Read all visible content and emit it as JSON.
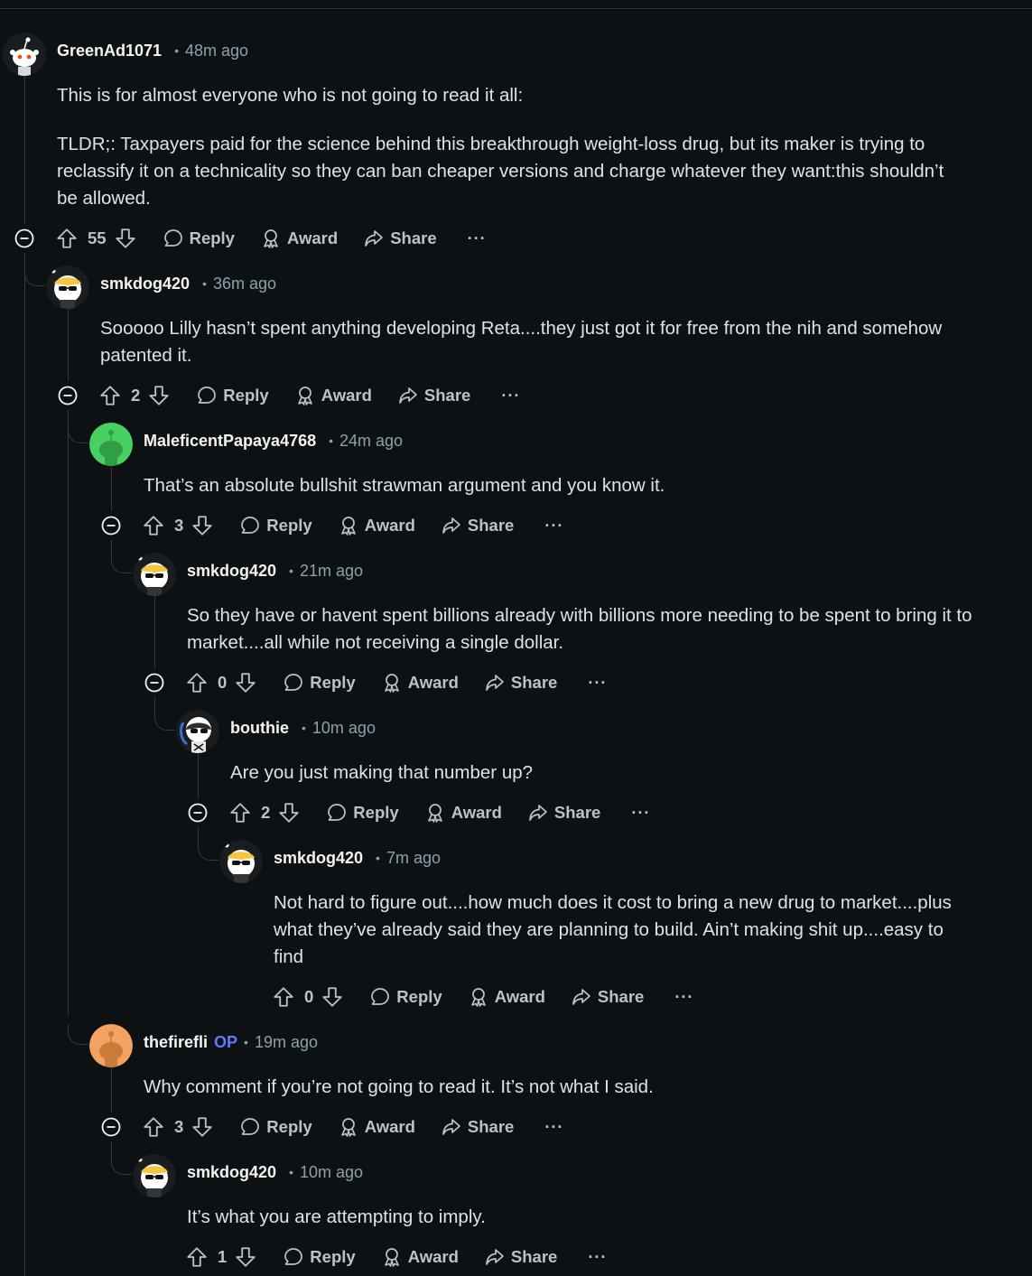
{
  "comments": [
    {
      "username": "GreenAd1071",
      "op": "",
      "time": "48m ago",
      "avatar": "white",
      "paragraphs": [
        "This is for almost everyone who is not going to read it all:",
        "TLDR;: Taxpayers paid for the science behind this breakthrough weight-loss drug, but its maker is trying to reclassify it on a technicality so they can ban cheaper versions and charge whatever they want:this shouldn’t be allowed."
      ],
      "score": "55",
      "actions": {
        "reply": "Reply",
        "award": "Award",
        "share": "Share",
        "more": "···"
      }
    },
    {
      "username": "smkdog420",
      "op": "",
      "time": "36m ago",
      "avatar": "snoo-glasses",
      "paragraphs": [
        "Sooooo Lilly hasn’t spent anything developing Reta....they just got it for free from the nih and somehow patented it."
      ],
      "score": "2",
      "actions": {
        "reply": "Reply",
        "award": "Award",
        "share": "Share",
        "more": "···"
      }
    },
    {
      "username": "MaleficentPapaya4768",
      "op": "",
      "time": "24m ago",
      "avatar": "green",
      "paragraphs": [
        "That’s an absolute bullshit strawman argument and you know it."
      ],
      "score": "3",
      "actions": {
        "reply": "Reply",
        "award": "Award",
        "share": "Share",
        "more": "···"
      }
    },
    {
      "username": "smkdog420",
      "op": "",
      "time": "21m ago",
      "avatar": "snoo-glasses",
      "paragraphs": [
        "So they have or havent spent billions already with billions more needing to be spent to bring it to market....all while not receiving a single dollar."
      ],
      "score": "0",
      "actions": {
        "reply": "Reply",
        "award": "Award",
        "share": "Share",
        "more": "···"
      }
    },
    {
      "username": "bouthie",
      "op": "",
      "time": "10m ago",
      "avatar": "snoo-dark",
      "paragraphs": [
        "Are you just making that number up?"
      ],
      "score": "2",
      "actions": {
        "reply": "Reply",
        "award": "Award",
        "share": "Share",
        "more": "···"
      }
    },
    {
      "username": "smkdog420",
      "op": "",
      "time": "7m ago",
      "avatar": "snoo-glasses",
      "paragraphs": [
        "Not hard to figure out....how much does it cost to bring a new drug to market....plus what they’ve already said they are planning to build. Ain’t making shit up....easy to find"
      ],
      "score": "0",
      "actions": {
        "reply": "Reply",
        "award": "Award",
        "share": "Share",
        "more": "···"
      }
    },
    {
      "username": "thefirefli",
      "op": "OP",
      "time": "19m ago",
      "avatar": "orange",
      "paragraphs": [
        "Why comment if you’re not going to read it. It’s not what I said."
      ],
      "score": "3",
      "actions": {
        "reply": "Reply",
        "award": "Award",
        "share": "Share",
        "more": "···"
      }
    },
    {
      "username": "smkdog420",
      "op": "",
      "time": "10m ago",
      "avatar": "snoo-glasses",
      "paragraphs": [
        "It’s what you are attempting to imply."
      ],
      "score": "1",
      "actions": {
        "reply": "Reply",
        "award": "Award",
        "share": "Share",
        "more": "···"
      }
    }
  ],
  "colors": {
    "background": "#0e1113",
    "text": "#f2f4f5",
    "meta": "#8ba2ad",
    "op": "#5c7cfa",
    "thread_line": "#33393d"
  }
}
